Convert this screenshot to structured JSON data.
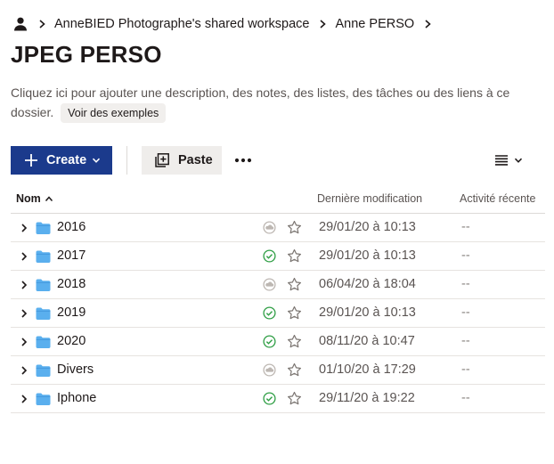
{
  "breadcrumb": {
    "items": [
      "AnneBIED Photographe's shared workspace",
      "Anne PERSO"
    ]
  },
  "page": {
    "title": "JPEG PERSO",
    "description": "Cliquez ici pour ajouter une description, des notes, des listes, des tâches ou des liens à ce dossier.",
    "examples_label": "Voir des exemples"
  },
  "toolbar": {
    "create_label": "Create",
    "paste_label": "Paste"
  },
  "table": {
    "columns": {
      "name": "Nom",
      "modified": "Dernière modification",
      "activity": "Activité récente"
    },
    "rows": [
      {
        "name": "2016",
        "status": "cloud",
        "modified": "29/01/20 à 10:13",
        "activity": "--"
      },
      {
        "name": "2017",
        "status": "synced",
        "modified": "29/01/20 à 10:13",
        "activity": "--"
      },
      {
        "name": "2018",
        "status": "cloud",
        "modified": "06/04/20 à 18:04",
        "activity": "--"
      },
      {
        "name": "2019",
        "status": "synced",
        "modified": "29/01/20 à 10:13",
        "activity": "--"
      },
      {
        "name": "2020",
        "status": "synced",
        "modified": "08/11/20 à 10:47",
        "activity": "--"
      },
      {
        "name": "Divers",
        "status": "cloud",
        "modified": "01/10/20 à 17:29",
        "activity": "--"
      },
      {
        "name": "Iphone",
        "status": "synced",
        "modified": "29/11/20 à 19:22",
        "activity": "--"
      }
    ]
  },
  "colors": {
    "primary": "#1b3a8c",
    "folder": "#5aafee",
    "synced": "#2e9e44",
    "cloud": "#bdb7b2"
  }
}
